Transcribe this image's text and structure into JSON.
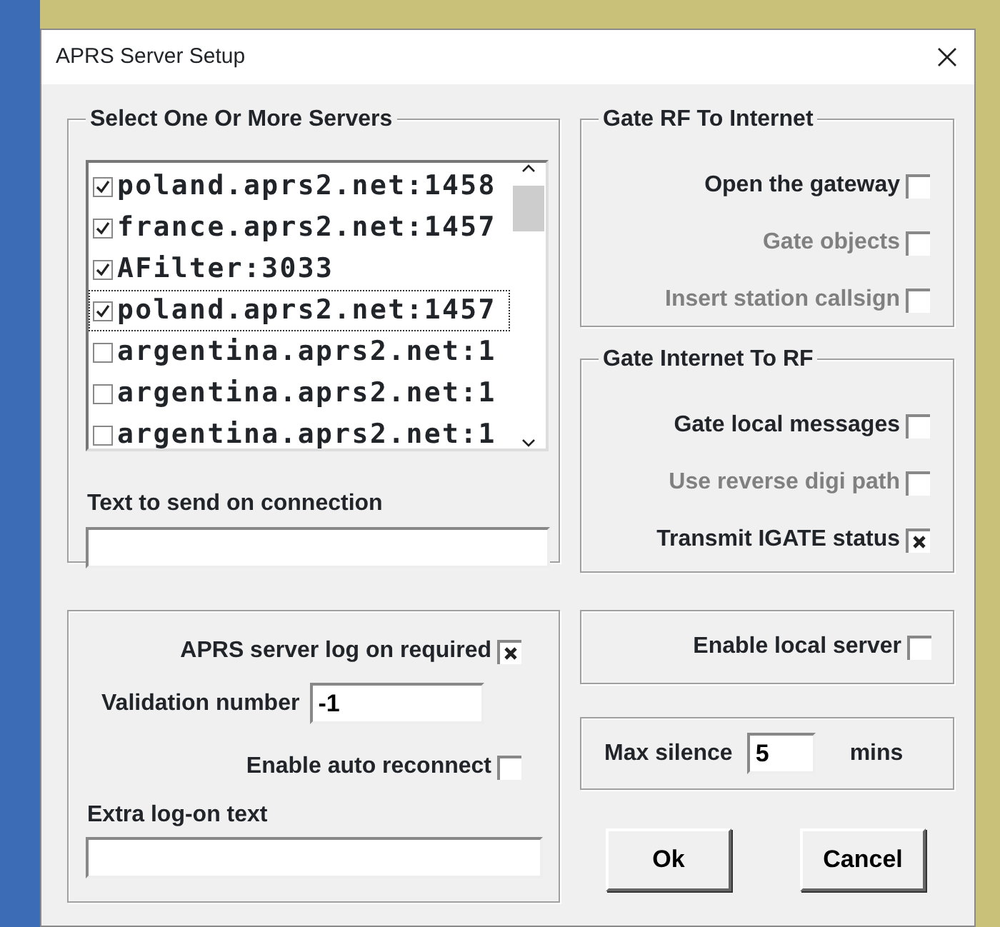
{
  "window": {
    "title": "APRS Server Setup"
  },
  "servers": {
    "title": "Select One Or More Servers",
    "items": [
      {
        "label": "poland.aprs2.net:1458",
        "checked": true,
        "selected": false
      },
      {
        "label": "france.aprs2.net:1457",
        "checked": true,
        "selected": false
      },
      {
        "label": "AFilter:3033",
        "checked": true,
        "selected": false
      },
      {
        "label": "poland.aprs2.net:1457",
        "checked": true,
        "selected": true
      },
      {
        "label": "argentina.aprs2.net:1",
        "checked": false,
        "selected": false
      },
      {
        "label": "argentina.aprs2.net:1",
        "checked": false,
        "selected": false
      },
      {
        "label": "argentina.aprs2.net:1",
        "checked": false,
        "selected": false
      }
    ],
    "connection_label": "Text to send on connection"
  },
  "logon": {
    "items": [
      {
        "kind": "checkbox",
        "label": "APRS server log on required",
        "checked": true
      },
      {
        "kind": "inline_field",
        "label": "Validation number",
        "value": "-1"
      },
      {
        "kind": "checkbox",
        "label": "Enable auto reconnect",
        "checked": false
      },
      {
        "kind": "block_field",
        "label": "Extra log-on text"
      }
    ]
  },
  "gate_rf_to_internet": {
    "title": "Gate RF To Internet",
    "options": [
      {
        "label": "Open the gateway",
        "checked": false,
        "disabled": false
      },
      {
        "label": "Gate objects",
        "checked": false,
        "disabled": true
      },
      {
        "label": "Insert station callsign",
        "checked": false,
        "disabled": true
      }
    ]
  },
  "gate_internet_to_rf": {
    "title": "Gate Internet To RF",
    "options": [
      {
        "label": "Gate local messages",
        "checked": false,
        "disabled": false
      },
      {
        "label": "Use reverse digi path",
        "checked": false,
        "disabled": true
      },
      {
        "label": "Transmit IGATE status",
        "checked": true,
        "disabled": false
      }
    ]
  },
  "local_server": {
    "label": "Enable local server",
    "checked": false
  },
  "max_silence": {
    "label": "Max silence",
    "value": "5",
    "unit": "mins"
  },
  "buttons": [
    "Ok",
    "Cancel"
  ]
}
